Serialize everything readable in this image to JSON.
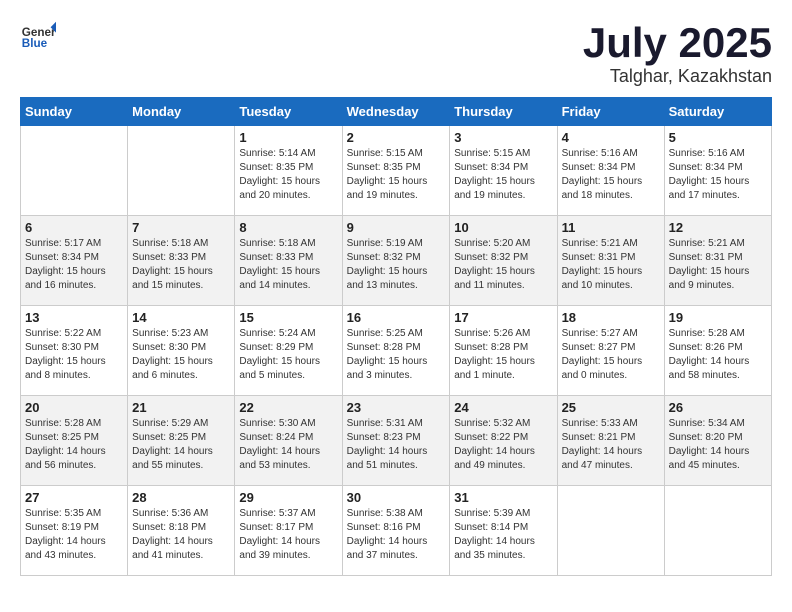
{
  "header": {
    "logo_general": "General",
    "logo_blue": "Blue",
    "month_year": "July 2025",
    "location": "Talghar, Kazakhstan"
  },
  "weekdays": [
    "Sunday",
    "Monday",
    "Tuesday",
    "Wednesday",
    "Thursday",
    "Friday",
    "Saturday"
  ],
  "weeks": [
    [
      {
        "day": "",
        "info": ""
      },
      {
        "day": "",
        "info": ""
      },
      {
        "day": "1",
        "info": "Sunrise: 5:14 AM\nSunset: 8:35 PM\nDaylight: 15 hours and 20 minutes."
      },
      {
        "day": "2",
        "info": "Sunrise: 5:15 AM\nSunset: 8:35 PM\nDaylight: 15 hours and 19 minutes."
      },
      {
        "day": "3",
        "info": "Sunrise: 5:15 AM\nSunset: 8:34 PM\nDaylight: 15 hours and 19 minutes."
      },
      {
        "day": "4",
        "info": "Sunrise: 5:16 AM\nSunset: 8:34 PM\nDaylight: 15 hours and 18 minutes."
      },
      {
        "day": "5",
        "info": "Sunrise: 5:16 AM\nSunset: 8:34 PM\nDaylight: 15 hours and 17 minutes."
      }
    ],
    [
      {
        "day": "6",
        "info": "Sunrise: 5:17 AM\nSunset: 8:34 PM\nDaylight: 15 hours and 16 minutes."
      },
      {
        "day": "7",
        "info": "Sunrise: 5:18 AM\nSunset: 8:33 PM\nDaylight: 15 hours and 15 minutes."
      },
      {
        "day": "8",
        "info": "Sunrise: 5:18 AM\nSunset: 8:33 PM\nDaylight: 15 hours and 14 minutes."
      },
      {
        "day": "9",
        "info": "Sunrise: 5:19 AM\nSunset: 8:32 PM\nDaylight: 15 hours and 13 minutes."
      },
      {
        "day": "10",
        "info": "Sunrise: 5:20 AM\nSunset: 8:32 PM\nDaylight: 15 hours and 11 minutes."
      },
      {
        "day": "11",
        "info": "Sunrise: 5:21 AM\nSunset: 8:31 PM\nDaylight: 15 hours and 10 minutes."
      },
      {
        "day": "12",
        "info": "Sunrise: 5:21 AM\nSunset: 8:31 PM\nDaylight: 15 hours and 9 minutes."
      }
    ],
    [
      {
        "day": "13",
        "info": "Sunrise: 5:22 AM\nSunset: 8:30 PM\nDaylight: 15 hours and 8 minutes."
      },
      {
        "day": "14",
        "info": "Sunrise: 5:23 AM\nSunset: 8:30 PM\nDaylight: 15 hours and 6 minutes."
      },
      {
        "day": "15",
        "info": "Sunrise: 5:24 AM\nSunset: 8:29 PM\nDaylight: 15 hours and 5 minutes."
      },
      {
        "day": "16",
        "info": "Sunrise: 5:25 AM\nSunset: 8:28 PM\nDaylight: 15 hours and 3 minutes."
      },
      {
        "day": "17",
        "info": "Sunrise: 5:26 AM\nSunset: 8:28 PM\nDaylight: 15 hours and 1 minute."
      },
      {
        "day": "18",
        "info": "Sunrise: 5:27 AM\nSunset: 8:27 PM\nDaylight: 15 hours and 0 minutes."
      },
      {
        "day": "19",
        "info": "Sunrise: 5:28 AM\nSunset: 8:26 PM\nDaylight: 14 hours and 58 minutes."
      }
    ],
    [
      {
        "day": "20",
        "info": "Sunrise: 5:28 AM\nSunset: 8:25 PM\nDaylight: 14 hours and 56 minutes."
      },
      {
        "day": "21",
        "info": "Sunrise: 5:29 AM\nSunset: 8:25 PM\nDaylight: 14 hours and 55 minutes."
      },
      {
        "day": "22",
        "info": "Sunrise: 5:30 AM\nSunset: 8:24 PM\nDaylight: 14 hours and 53 minutes."
      },
      {
        "day": "23",
        "info": "Sunrise: 5:31 AM\nSunset: 8:23 PM\nDaylight: 14 hours and 51 minutes."
      },
      {
        "day": "24",
        "info": "Sunrise: 5:32 AM\nSunset: 8:22 PM\nDaylight: 14 hours and 49 minutes."
      },
      {
        "day": "25",
        "info": "Sunrise: 5:33 AM\nSunset: 8:21 PM\nDaylight: 14 hours and 47 minutes."
      },
      {
        "day": "26",
        "info": "Sunrise: 5:34 AM\nSunset: 8:20 PM\nDaylight: 14 hours and 45 minutes."
      }
    ],
    [
      {
        "day": "27",
        "info": "Sunrise: 5:35 AM\nSunset: 8:19 PM\nDaylight: 14 hours and 43 minutes."
      },
      {
        "day": "28",
        "info": "Sunrise: 5:36 AM\nSunset: 8:18 PM\nDaylight: 14 hours and 41 minutes."
      },
      {
        "day": "29",
        "info": "Sunrise: 5:37 AM\nSunset: 8:17 PM\nDaylight: 14 hours and 39 minutes."
      },
      {
        "day": "30",
        "info": "Sunrise: 5:38 AM\nSunset: 8:16 PM\nDaylight: 14 hours and 37 minutes."
      },
      {
        "day": "31",
        "info": "Sunrise: 5:39 AM\nSunset: 8:14 PM\nDaylight: 14 hours and 35 minutes."
      },
      {
        "day": "",
        "info": ""
      },
      {
        "day": "",
        "info": ""
      }
    ]
  ]
}
